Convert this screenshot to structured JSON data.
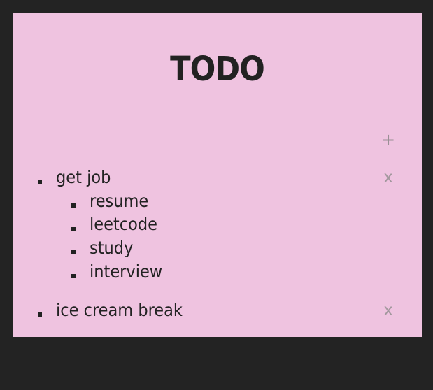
{
  "app": {
    "title": "TODO"
  },
  "new_item": {
    "value": "",
    "add_label": "+"
  },
  "items": [
    {
      "label": "get job",
      "delete_label": "x",
      "subitems": [
        "resume",
        "leetcode",
        "study",
        "interview"
      ]
    },
    {
      "label": "ice cream break",
      "delete_label": "x",
      "subitems": []
    }
  ]
}
